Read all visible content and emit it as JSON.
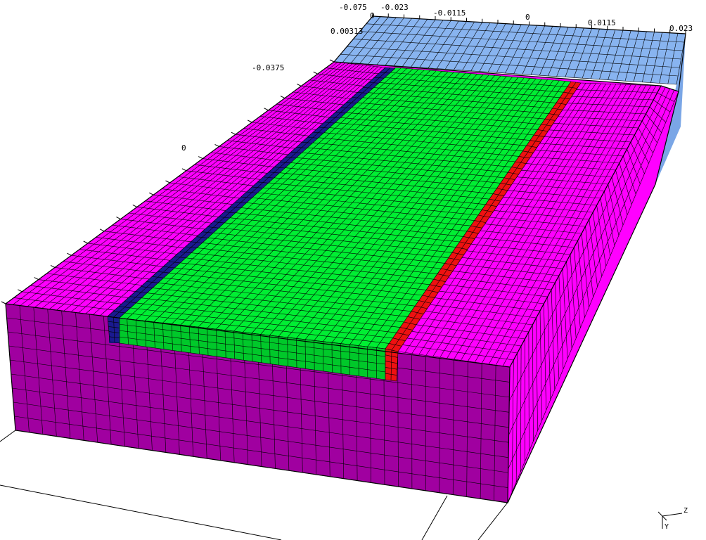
{
  "colors": {
    "background": "#ffffff",
    "soil_top": "#ff00ff",
    "soil_side": "#a000a0",
    "back_block": "#88b4f0",
    "slab": "#00ee33",
    "strip_left": "#1a1a90",
    "strip_right": "#ee1111",
    "grid_line": "#000000"
  },
  "axis_ticks": {
    "top_a": "-0.075",
    "top_b": "-0.023",
    "top_c": "-0.0115",
    "top_d": "0",
    "top_e": "0.0115",
    "top_f": "0.023",
    "top_g": "0",
    "left_a": "0.00313",
    "left_b": "-0.0375",
    "left_c": "0"
  },
  "triad": {
    "z": "Z",
    "y": "Y"
  }
}
